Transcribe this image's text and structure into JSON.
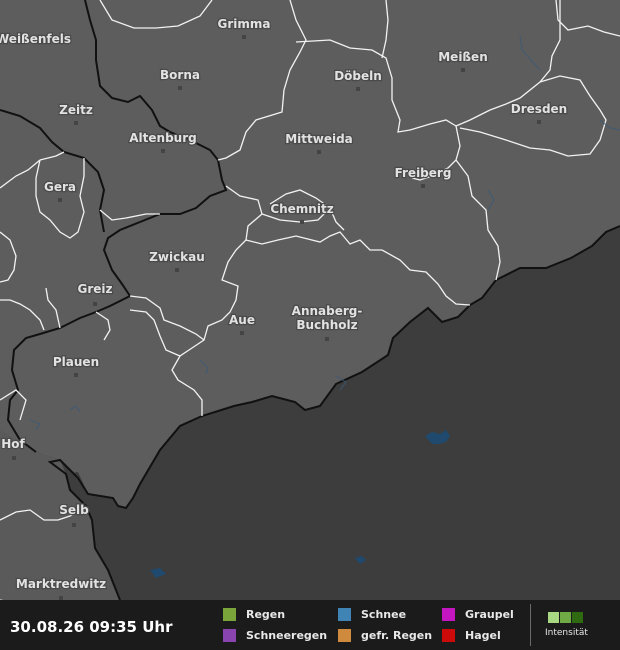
{
  "cities": [
    {
      "id": "weissenfels",
      "name": "Weißenfels"
    },
    {
      "id": "grimma",
      "name": "Grimma"
    },
    {
      "id": "borna",
      "name": "Borna"
    },
    {
      "id": "doebeln",
      "name": "Döbeln"
    },
    {
      "id": "meissen",
      "name": "Meißen"
    },
    {
      "id": "zeitz",
      "name": "Zeitz"
    },
    {
      "id": "dresden",
      "name": "Dresden"
    },
    {
      "id": "altenburg",
      "name": "Altenburg"
    },
    {
      "id": "mittweida",
      "name": "Mittweida"
    },
    {
      "id": "freiberg",
      "name": "Freiberg"
    },
    {
      "id": "gera",
      "name": "Gera"
    },
    {
      "id": "chemnitz",
      "name": "Chemnitz"
    },
    {
      "id": "zwickau",
      "name": "Zwickau"
    },
    {
      "id": "greiz",
      "name": "Greiz"
    },
    {
      "id": "aue",
      "name": "Aue"
    },
    {
      "id": "annaberg",
      "name": "Annaberg-",
      "name2": "Buchholz"
    },
    {
      "id": "plauen",
      "name": "Plauen"
    },
    {
      "id": "hof",
      "name": "Hof"
    },
    {
      "id": "selb",
      "name": "Selb"
    },
    {
      "id": "marktredwitz",
      "name": "Marktredwitz"
    }
  ],
  "footer": {
    "timestamp": "30.08.26 09:35 Uhr",
    "legend": [
      {
        "label": "Regen",
        "color": "#7aa53a"
      },
      {
        "label": "Schnee",
        "color": "#3f84b5"
      },
      {
        "label": "Graupel",
        "color": "#c316c0"
      },
      {
        "label": "Schneeregen",
        "color": "#8a44b0"
      },
      {
        "label": "gefr. Regen",
        "color": "#d08a3e"
      },
      {
        "label": "Hagel",
        "color": "#cc0a0a"
      }
    ],
    "intensity_label": "Intensität",
    "intensity_colors": [
      "#a8d884",
      "#6faa45",
      "#2f6a12"
    ]
  }
}
